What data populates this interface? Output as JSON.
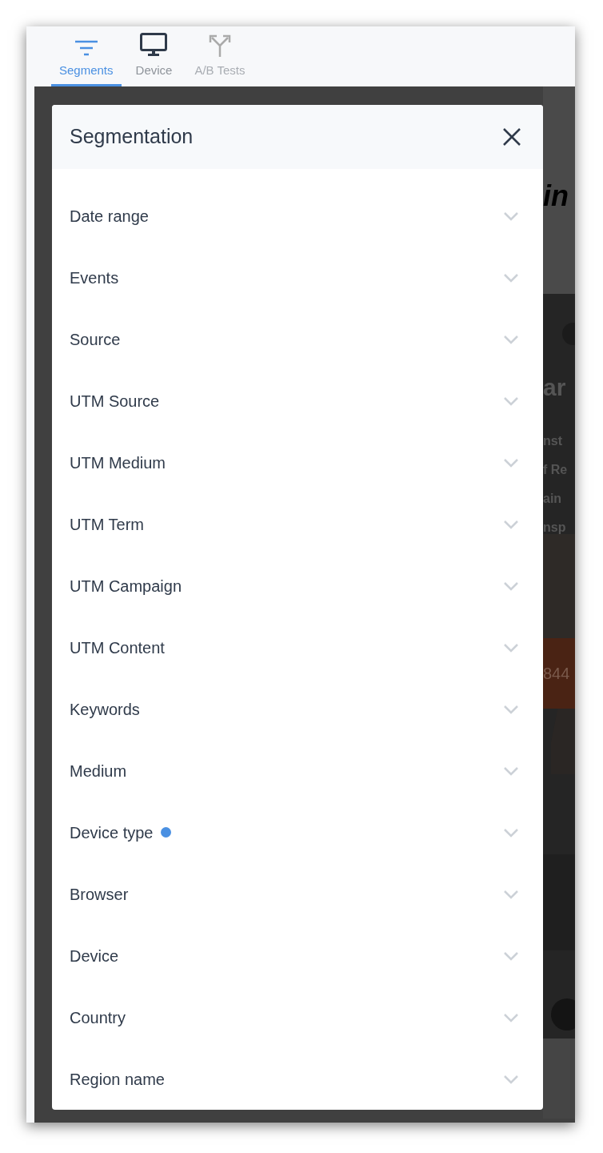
{
  "tabs": [
    {
      "label": "Segments",
      "kind": "filter",
      "selected": true,
      "disabled": false
    },
    {
      "label": "Device",
      "kind": "monitor",
      "selected": false,
      "disabled": false
    },
    {
      "label": "A/B Tests",
      "kind": "split",
      "selected": false,
      "disabled": true
    }
  ],
  "background_page": {
    "heading": "in",
    "title": "ar",
    "lines": [
      "nst",
      "f Re",
      "ain",
      "nsp"
    ],
    "phone": "844"
  },
  "modal": {
    "title": "Segmentation",
    "filters": [
      {
        "label": "Date range",
        "active": false
      },
      {
        "label": "Events",
        "active": false
      },
      {
        "label": "Source",
        "active": false
      },
      {
        "label": "UTM Source",
        "active": false
      },
      {
        "label": "UTM Medium",
        "active": false
      },
      {
        "label": "UTM Term",
        "active": false
      },
      {
        "label": "UTM Campaign",
        "active": false
      },
      {
        "label": "UTM Content",
        "active": false
      },
      {
        "label": "Keywords",
        "active": false
      },
      {
        "label": "Medium",
        "active": false
      },
      {
        "label": "Device type",
        "active": true
      },
      {
        "label": "Browser",
        "active": false
      },
      {
        "label": "Device",
        "active": false
      },
      {
        "label": "Country",
        "active": false
      },
      {
        "label": "Region name",
        "active": false
      }
    ]
  }
}
